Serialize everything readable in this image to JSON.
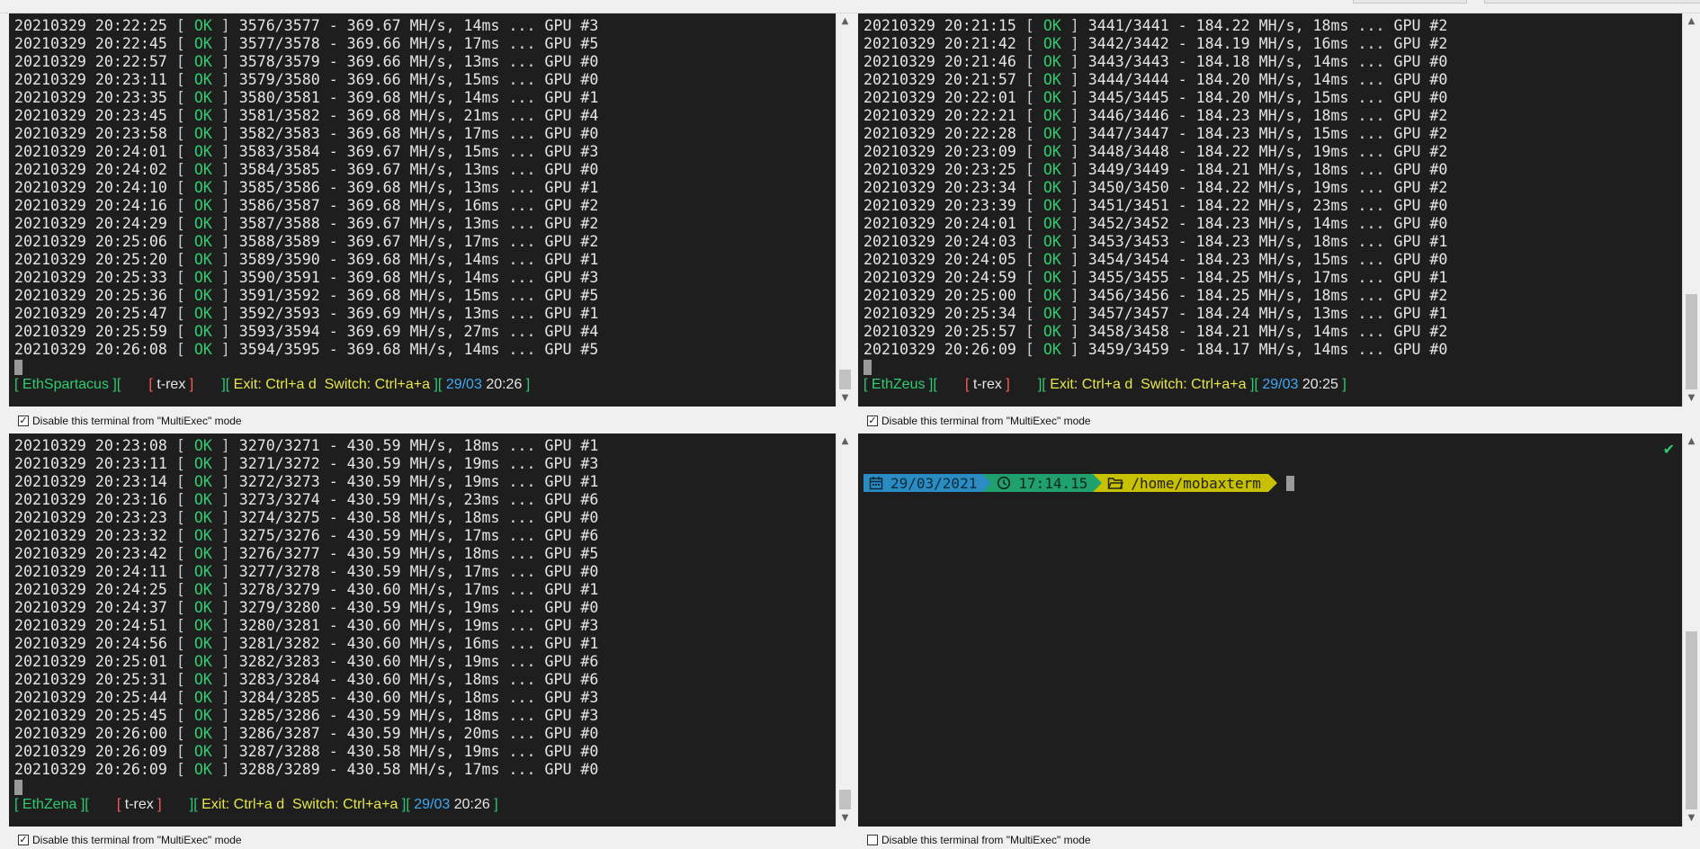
{
  "colors": {
    "terminal_bg": "#1e1e1e",
    "ok_green": "#2ecc71",
    "status_red": "#ff5c5c",
    "status_yellow": "#e6e64b",
    "status_cyan": "#3fa9f5",
    "prompt_date_bg": "#2b8cc4",
    "prompt_time_bg": "#1fa06d",
    "prompt_path_bg": "#c8c100"
  },
  "checkbox_label": "Disable this terminal from \"MultiExec\" mode",
  "panes": [
    {
      "name": "EthSpartacus",
      "app": "t-rex",
      "exit_label": "Exit:",
      "exit_key": "Ctrl+a d",
      "switch_label": "Switch:",
      "switch_key": "Ctrl+a+a",
      "date": "29/03",
      "time": "20:26",
      "lines": [
        {
          "ts": "20210329 20:22:25",
          "msg": "3576/3577 - 369.67 MH/s, 14ms ... GPU #3"
        },
        {
          "ts": "20210329 20:22:45",
          "msg": "3577/3578 - 369.66 MH/s, 17ms ... GPU #5"
        },
        {
          "ts": "20210329 20:22:57",
          "msg": "3578/3579 - 369.66 MH/s, 13ms ... GPU #0"
        },
        {
          "ts": "20210329 20:23:11",
          "msg": "3579/3580 - 369.66 MH/s, 15ms ... GPU #0"
        },
        {
          "ts": "20210329 20:23:35",
          "msg": "3580/3581 - 369.68 MH/s, 14ms ... GPU #1"
        },
        {
          "ts": "20210329 20:23:45",
          "msg": "3581/3582 - 369.68 MH/s, 21ms ... GPU #4"
        },
        {
          "ts": "20210329 20:23:58",
          "msg": "3582/3583 - 369.68 MH/s, 17ms ... GPU #0"
        },
        {
          "ts": "20210329 20:24:01",
          "msg": "3583/3584 - 369.67 MH/s, 15ms ... GPU #3"
        },
        {
          "ts": "20210329 20:24:02",
          "msg": "3584/3585 - 369.67 MH/s, 13ms ... GPU #0"
        },
        {
          "ts": "20210329 20:24:10",
          "msg": "3585/3586 - 369.68 MH/s, 13ms ... GPU #1"
        },
        {
          "ts": "20210329 20:24:16",
          "msg": "3586/3587 - 369.68 MH/s, 16ms ... GPU #2"
        },
        {
          "ts": "20210329 20:24:29",
          "msg": "3587/3588 - 369.67 MH/s, 13ms ... GPU #2"
        },
        {
          "ts": "20210329 20:25:06",
          "msg": "3588/3589 - 369.67 MH/s, 17ms ... GPU #2"
        },
        {
          "ts": "20210329 20:25:20",
          "msg": "3589/3590 - 369.68 MH/s, 14ms ... GPU #1"
        },
        {
          "ts": "20210329 20:25:33",
          "msg": "3590/3591 - 369.68 MH/s, 14ms ... GPU #3"
        },
        {
          "ts": "20210329 20:25:36",
          "msg": "3591/3592 - 369.68 MH/s, 15ms ... GPU #5"
        },
        {
          "ts": "20210329 20:25:47",
          "msg": "3592/3593 - 369.69 MH/s, 13ms ... GPU #1"
        },
        {
          "ts": "20210329 20:25:59",
          "msg": "3593/3594 - 369.69 MH/s, 27ms ... GPU #4"
        },
        {
          "ts": "20210329 20:26:08",
          "msg": "3594/3595 - 369.68 MH/s, 14ms ... GPU #5"
        }
      ]
    },
    {
      "name": "EthZeus",
      "app": "t-rex",
      "exit_label": "Exit:",
      "exit_key": "Ctrl+a d",
      "switch_label": "Switch:",
      "switch_key": "Ctrl+a+a",
      "date": "29/03",
      "time": "20:25",
      "lines": [
        {
          "ts": "20210329 20:21:15",
          "msg": "3441/3441 - 184.22 MH/s, 18ms ... GPU #2"
        },
        {
          "ts": "20210329 20:21:42",
          "msg": "3442/3442 - 184.19 MH/s, 16ms ... GPU #2"
        },
        {
          "ts": "20210329 20:21:46",
          "msg": "3443/3443 - 184.18 MH/s, 14ms ... GPU #0"
        },
        {
          "ts": "20210329 20:21:57",
          "msg": "3444/3444 - 184.20 MH/s, 14ms ... GPU #0"
        },
        {
          "ts": "20210329 20:22:01",
          "msg": "3445/3445 - 184.20 MH/s, 15ms ... GPU #0"
        },
        {
          "ts": "20210329 20:22:21",
          "msg": "3446/3446 - 184.23 MH/s, 18ms ... GPU #2"
        },
        {
          "ts": "20210329 20:22:28",
          "msg": "3447/3447 - 184.23 MH/s, 15ms ... GPU #2"
        },
        {
          "ts": "20210329 20:23:09",
          "msg": "3448/3448 - 184.22 MH/s, 19ms ... GPU #2"
        },
        {
          "ts": "20210329 20:23:25",
          "msg": "3449/3449 - 184.21 MH/s, 18ms ... GPU #0"
        },
        {
          "ts": "20210329 20:23:34",
          "msg": "3450/3450 - 184.22 MH/s, 19ms ... GPU #2"
        },
        {
          "ts": "20210329 20:23:39",
          "msg": "3451/3451 - 184.22 MH/s, 23ms ... GPU #0"
        },
        {
          "ts": "20210329 20:24:01",
          "msg": "3452/3452 - 184.23 MH/s, 14ms ... GPU #0"
        },
        {
          "ts": "20210329 20:24:03",
          "msg": "3453/3453 - 184.23 MH/s, 18ms ... GPU #1"
        },
        {
          "ts": "20210329 20:24:05",
          "msg": "3454/3454 - 184.23 MH/s, 15ms ... GPU #0"
        },
        {
          "ts": "20210329 20:24:59",
          "msg": "3455/3455 - 184.25 MH/s, 17ms ... GPU #1"
        },
        {
          "ts": "20210329 20:25:00",
          "msg": "3456/3456 - 184.25 MH/s, 18ms ... GPU #2"
        },
        {
          "ts": "20210329 20:25:34",
          "msg": "3457/3457 - 184.24 MH/s, 13ms ... GPU #1"
        },
        {
          "ts": "20210329 20:25:57",
          "msg": "3458/3458 - 184.21 MH/s, 14ms ... GPU #2"
        },
        {
          "ts": "20210329 20:26:09",
          "msg": "3459/3459 - 184.17 MH/s, 14ms ... GPU #0"
        }
      ]
    },
    {
      "name": "EthZena",
      "app": "t-rex",
      "exit_label": "Exit:",
      "exit_key": "Ctrl+a d",
      "switch_label": "Switch:",
      "switch_key": "Ctrl+a+a",
      "date": "29/03",
      "time": "20:26",
      "lines": [
        {
          "ts": "20210329 20:23:08",
          "msg": "3270/3271 - 430.59 MH/s, 18ms ... GPU #1"
        },
        {
          "ts": "20210329 20:23:11",
          "msg": "3271/3272 - 430.59 MH/s, 19ms ... GPU #3"
        },
        {
          "ts": "20210329 20:23:14",
          "msg": "3272/3273 - 430.59 MH/s, 19ms ... GPU #1"
        },
        {
          "ts": "20210329 20:23:16",
          "msg": "3273/3274 - 430.59 MH/s, 23ms ... GPU #6"
        },
        {
          "ts": "20210329 20:23:23",
          "msg": "3274/3275 - 430.58 MH/s, 18ms ... GPU #0"
        },
        {
          "ts": "20210329 20:23:32",
          "msg": "3275/3276 - 430.59 MH/s, 17ms ... GPU #6"
        },
        {
          "ts": "20210329 20:23:42",
          "msg": "3276/3277 - 430.59 MH/s, 18ms ... GPU #5"
        },
        {
          "ts": "20210329 20:24:11",
          "msg": "3277/3278 - 430.59 MH/s, 17ms ... GPU #0"
        },
        {
          "ts": "20210329 20:24:25",
          "msg": "3278/3279 - 430.60 MH/s, 17ms ... GPU #1"
        },
        {
          "ts": "20210329 20:24:37",
          "msg": "3279/3280 - 430.59 MH/s, 19ms ... GPU #0"
        },
        {
          "ts": "20210329 20:24:51",
          "msg": "3280/3281 - 430.60 MH/s, 19ms ... GPU #3"
        },
        {
          "ts": "20210329 20:24:56",
          "msg": "3281/3282 - 430.60 MH/s, 16ms ... GPU #1"
        },
        {
          "ts": "20210329 20:25:01",
          "msg": "3282/3283 - 430.60 MH/s, 19ms ... GPU #6"
        },
        {
          "ts": "20210329 20:25:31",
          "msg": "3283/3284 - 430.60 MH/s, 18ms ... GPU #6"
        },
        {
          "ts": "20210329 20:25:44",
          "msg": "3284/3285 - 430.60 MH/s, 18ms ... GPU #3"
        },
        {
          "ts": "20210329 20:25:45",
          "msg": "3285/3286 - 430.59 MH/s, 18ms ... GPU #3"
        },
        {
          "ts": "20210329 20:26:00",
          "msg": "3286/3287 - 430.59 MH/s, 20ms ... GPU #0"
        },
        {
          "ts": "20210329 20:26:09",
          "msg": "3287/3288 - 430.58 MH/s, 19ms ... GPU #0"
        },
        {
          "ts": "20210329 20:26:09",
          "msg": "3288/3289 - 430.58 MH/s, 17ms ... GPU #0"
        }
      ]
    }
  ],
  "local_terminal": {
    "date": "29/03/2021",
    "time": "17:14.15",
    "path": "/home/mobaxterm",
    "calendar_icon": "calendar-icon",
    "clock_icon": "clock-icon",
    "folder_icon": "folder-icon",
    "tick_icon": "checkmark-icon"
  }
}
